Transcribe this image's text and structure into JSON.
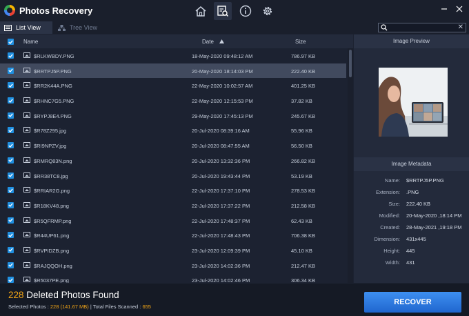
{
  "app": {
    "title": "Photos Recovery"
  },
  "tabs": {
    "list_view": "List View",
    "tree_view": "Tree View"
  },
  "search": {
    "placeholder": "",
    "clear": "✕"
  },
  "table": {
    "headers": {
      "name": "Name",
      "date": "Date",
      "size": "Size"
    },
    "sort": {
      "column": "Date",
      "direction": "ascending"
    },
    "rows": [
      {
        "name": "$RLKWBDY.PNG",
        "date": "18-May-2020 09:48:12 AM",
        "size": "786.97 KB"
      },
      {
        "name": "$RRTPJ5P.PNG",
        "date": "20-May-2020 18:14:03 PM",
        "size": "222.40 KB",
        "selected": true
      },
      {
        "name": "$RR2K44A.PNG",
        "date": "22-May-2020 10:02:57 AM",
        "size": "401.25 KB"
      },
      {
        "name": "$RHNC7G5.PNG",
        "date": "22-May-2020 12:15:53 PM",
        "size": "37.82 KB"
      },
      {
        "name": "$RYPJ8E4.PNG",
        "date": "29-May-2020 17:45:13 PM",
        "size": "245.67 KB"
      },
      {
        "name": "$R78Z295.jpg",
        "date": "20-Jul-2020 08:39:16 AM",
        "size": "55.96 KB"
      },
      {
        "name": "$RI9NPZV.jpg",
        "date": "20-Jul-2020 08:47:55 AM",
        "size": "56.50 KB"
      },
      {
        "name": "$RMRQ83N.png",
        "date": "20-Jul-2020 13:32:36 PM",
        "size": "266.82 KB"
      },
      {
        "name": "$RR38TC8.jpg",
        "date": "20-Jul-2020 19:43:44 PM",
        "size": "53.19 KB"
      },
      {
        "name": "$RRIAR2G.png",
        "date": "22-Jul-2020 17:37:10 PM",
        "size": "278.53 KB"
      },
      {
        "name": "$R18KV48.png",
        "date": "22-Jul-2020 17:37:22 PM",
        "size": "212.58 KB"
      },
      {
        "name": "$R5QFRMP.png",
        "date": "22-Jul-2020 17:48:37 PM",
        "size": "62.43 KB"
      },
      {
        "name": "$R44UP61.png",
        "date": "22-Jul-2020 17:48:43 PM",
        "size": "706.38 KB"
      },
      {
        "name": "$RVPIDZB.png",
        "date": "23-Jul-2020 12:09:39 PM",
        "size": "45.10 KB"
      },
      {
        "name": "$RAJQQOH.png",
        "date": "23-Jul-2020 14:02:36 PM",
        "size": "212.47 KB"
      },
      {
        "name": "$R5037PE.png",
        "date": "23-Jul-2020 14:02:46 PM",
        "size": "306.34 KB"
      }
    ]
  },
  "preview": {
    "heading": "Image Preview"
  },
  "metadata": {
    "heading": "Image Metadata",
    "items": [
      {
        "label": "Name:",
        "value": "$RRTPJ5P.PNG"
      },
      {
        "label": "Extension:",
        "value": ".PNG"
      },
      {
        "label": "Size:",
        "value": "222.40 KB"
      },
      {
        "label": "Modified:",
        "value": "20-May-2020 ,18:14 PM"
      },
      {
        "label": "Created:",
        "value": "28-May-2021 ,19:18 PM"
      },
      {
        "label": "Dimension:",
        "value": "431x445"
      },
      {
        "label": "Height:",
        "value": "445"
      },
      {
        "label": "Width:",
        "value": "431"
      }
    ]
  },
  "footer": {
    "count": "228",
    "found_text": "Deleted Photos Found",
    "selected_label": "Selected Photos : ",
    "selected_value": "228 (141.67 MB)",
    "separator": " | ",
    "scanned_label": "Total Files Scanned : ",
    "scanned_value": "655"
  },
  "actions": {
    "recover": "RECOVER"
  },
  "colors": {
    "accent": "#1f8fe0",
    "highlight": "#f2a516",
    "button": "#2f7fe6"
  }
}
